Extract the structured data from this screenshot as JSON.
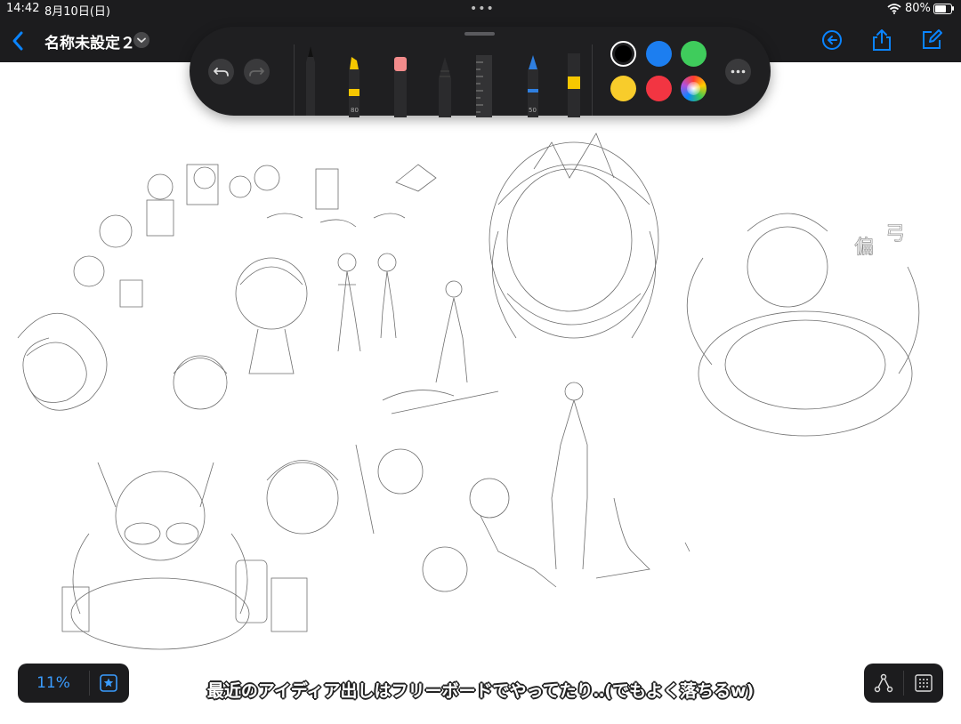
{
  "status_bar": {
    "time": "14:42",
    "date": "8月10日(日)",
    "multitask_dots": "•••",
    "battery_percent": "80%",
    "battery_level": 0.8,
    "wifi_icon": "wifi-icon",
    "battery_icon": "battery-icon"
  },
  "nav": {
    "back_icon": "chevron-left-icon",
    "title": "名称未設定２",
    "title_menu_icon": "chevron-down-icon",
    "undo_history_icon": "clock-arrow-icon",
    "share_icon": "share-icon",
    "new_board_icon": "compose-icon",
    "accent_color": "#0a84ff"
  },
  "toolbar": {
    "undo_icon": "undo-icon",
    "redo_icon": "redo-icon",
    "tools": [
      {
        "name": "pen",
        "label": ""
      },
      {
        "name": "marker",
        "label": "80"
      },
      {
        "name": "eraser",
        "label": ""
      },
      {
        "name": "pencil",
        "label": ""
      },
      {
        "name": "ruler",
        "label": ""
      },
      {
        "name": "fountain-pen",
        "label": "50"
      },
      {
        "name": "highlighter",
        "label": ""
      }
    ],
    "colors": [
      "#000000",
      "#1c7ef0",
      "#3fcc5c",
      "#f8cc2b",
      "#f23542",
      "multicolor"
    ],
    "selected_color": "#000000",
    "more_icon": "ellipsis-icon"
  },
  "zoom": {
    "level": "11%",
    "favorite_icon": "star-icon"
  },
  "bottom_right": {
    "connector_icon": "connector-icon",
    "grid_icon": "grid-icon"
  },
  "caption": "最近のアイディア出しはフリーボードでやってたり‥(でもよく落ちるw)"
}
